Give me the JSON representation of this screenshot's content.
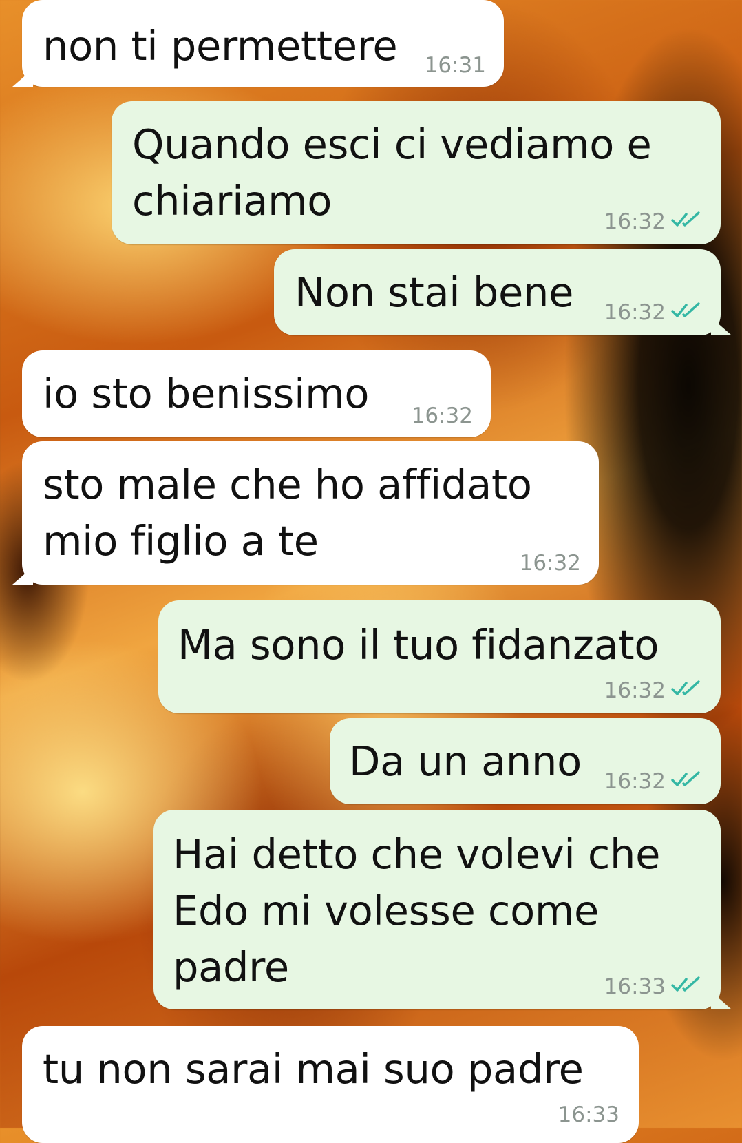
{
  "messages": [
    {
      "direction": "incoming",
      "lines": [
        "non ti permettere"
      ],
      "time": "16:31"
    },
    {
      "direction": "outgoing",
      "lines": [
        "Quando esci ci vediamo e",
        "chiariamo"
      ],
      "time": "16:32",
      "status_icon": "double-check-icon"
    },
    {
      "direction": "outgoing",
      "lines": [
        "Non stai bene"
      ],
      "time": "16:32",
      "status_icon": "double-check-icon"
    },
    {
      "direction": "incoming",
      "lines": [
        "io sto benissimo"
      ],
      "time": "16:32"
    },
    {
      "direction": "incoming",
      "lines": [
        "sto male che ho affidato",
        "mio figlio a te"
      ],
      "time": "16:32"
    },
    {
      "direction": "outgoing",
      "lines": [
        "Ma sono il tuo fidanzato"
      ],
      "time": "16:32",
      "status_icon": "double-check-icon"
    },
    {
      "direction": "outgoing",
      "lines": [
        "Da un anno"
      ],
      "time": "16:32",
      "status_icon": "double-check-icon"
    },
    {
      "direction": "outgoing",
      "lines": [
        "Hai detto che volevi che",
        "Edo mi volesse come",
        "padre"
      ],
      "time": "16:33",
      "status_icon": "double-check-icon"
    },
    {
      "direction": "incoming",
      "lines": [
        "tu non sarai mai suo padre"
      ],
      "time": "16:33"
    }
  ],
  "colors": {
    "incoming_bubble": "#ffffff",
    "outgoing_bubble": "#e7f7e3",
    "read_tick": "#34b7a4",
    "timestamp": "#8c9590"
  }
}
